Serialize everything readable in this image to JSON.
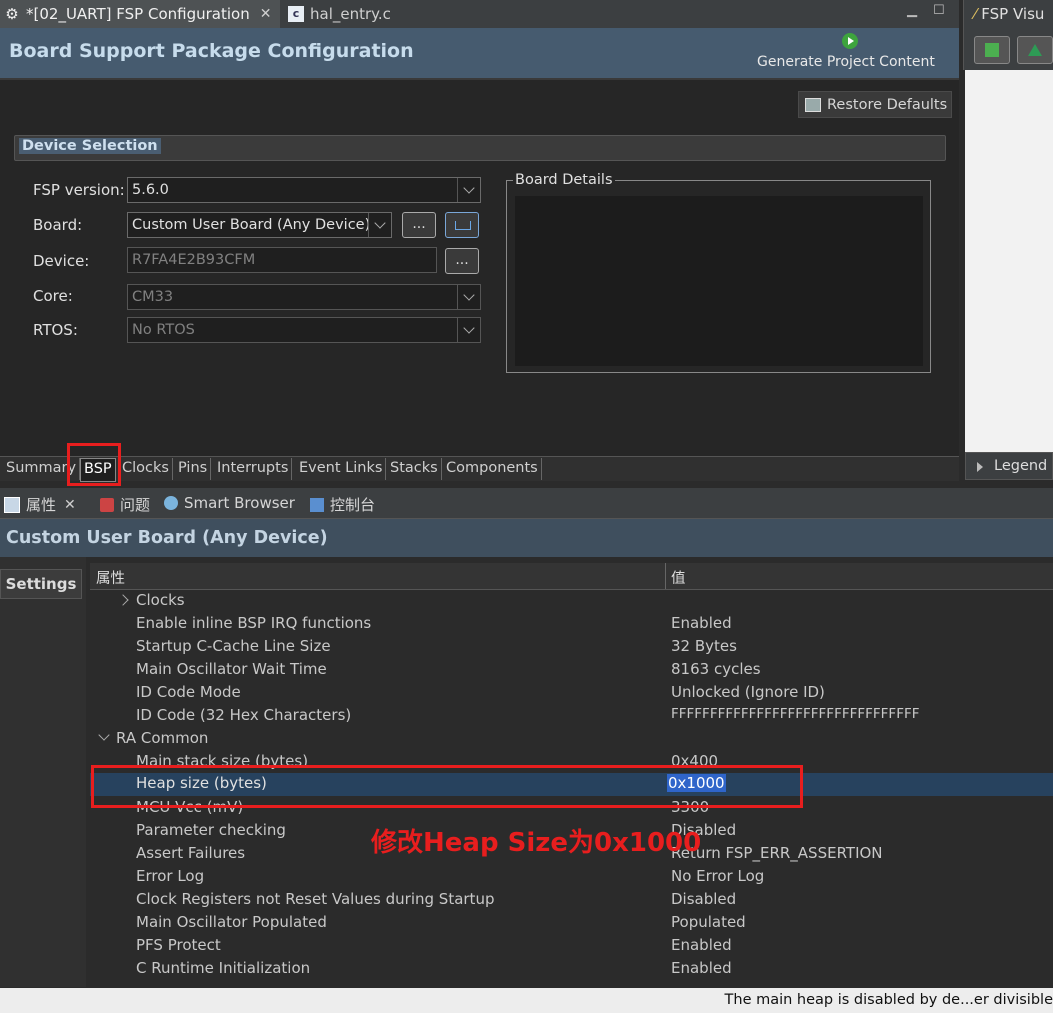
{
  "editor_tabs": [
    {
      "label": "*[02_UART] FSP Configuration",
      "icon": "gear-icon"
    },
    {
      "label": "hal_entry.c",
      "icon": "c-file-icon"
    }
  ],
  "header": {
    "title": "Board Support Package Configuration",
    "generate_label": "Generate Project Content"
  },
  "restore_defaults": "Restore Defaults",
  "device_selection": {
    "section_title": "Device Selection",
    "fields": [
      {
        "label": "FSP version:",
        "value": "5.6.0"
      },
      {
        "label": "Board:",
        "value": "Custom User Board (Any Device)"
      },
      {
        "label": "Device:",
        "value": "R7FA4E2B93CFM"
      },
      {
        "label": "Core:",
        "value": "CM33"
      },
      {
        "label": "RTOS:",
        "value": "No RTOS"
      }
    ],
    "dots": "...",
    "board_details_title": "Board Details"
  },
  "bottom_tabs": [
    "Summary",
    "BSP",
    "Clocks",
    "Pins",
    "Interrupts",
    "Event Links",
    "Stacks",
    "Components"
  ],
  "right_panel": {
    "title": "FSP Visu",
    "legend": "Legend"
  },
  "props_tabs": [
    "属性",
    "问题",
    "Smart Browser",
    "控制台"
  ],
  "props_title": "Custom User Board (Any Device)",
  "settings_tab": "Settings",
  "table": {
    "col_property": "属性",
    "col_value": "值",
    "rows": [
      {
        "name": "Clocks",
        "value": ""
      },
      {
        "name": "Enable inline BSP IRQ functions",
        "value": "Enabled"
      },
      {
        "name": "Startup C-Cache Line Size",
        "value": "32 Bytes"
      },
      {
        "name": "Main Oscillator Wait Time",
        "value": "8163 cycles"
      },
      {
        "name": "ID Code Mode",
        "value": "Unlocked (Ignore ID)"
      },
      {
        "name": "ID Code (32 Hex Characters)",
        "value": "FFFFFFFFFFFFFFFFFFFFFFFFFFFFFFFF"
      },
      {
        "name": "RA Common",
        "value": ""
      },
      {
        "name": "Main stack size (bytes)",
        "value": "0x400"
      },
      {
        "name": "Heap size (bytes)",
        "value": "0x1000"
      },
      {
        "name": "MCU Vcc (mV)",
        "value": "3300"
      },
      {
        "name": "Parameter checking",
        "value": "Disabled"
      },
      {
        "name": "Assert Failures",
        "value": "Return FSP_ERR_ASSERTION"
      },
      {
        "name": "Error Log",
        "value": "No Error Log"
      },
      {
        "name": "Clock Registers not Reset Values during Startup",
        "value": "Disabled"
      },
      {
        "name": "Main Oscillator Populated",
        "value": "Populated"
      },
      {
        "name": "PFS Protect",
        "value": "Enabled"
      },
      {
        "name": "C Runtime Initialization",
        "value": "Enabled"
      }
    ]
  },
  "annotation": "修改Heap Size为0x1000",
  "status": "The main heap is disabled by de...er divisible",
  "colors": {
    "highlight": "#e81e1e",
    "selection": "#2f65ca",
    "header_bg": "#465b6f"
  }
}
